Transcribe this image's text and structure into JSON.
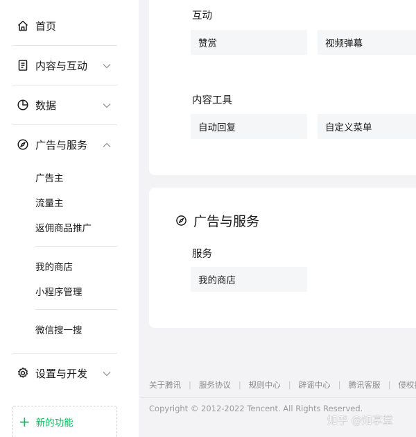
{
  "sidebar": {
    "home": {
      "label": "首页",
      "icon": "home-icon"
    },
    "content": {
      "label": "内容与互动",
      "icon": "document-icon"
    },
    "data": {
      "label": "数据",
      "icon": "pie-chart-icon"
    },
    "ads": {
      "label": "广告与服务",
      "icon": "compass-icon",
      "sub_items": [
        {
          "label": "广告主"
        },
        {
          "label": "流量主"
        },
        {
          "label": "返佣商品推广"
        },
        {
          "label": "我的商店"
        },
        {
          "label": "小程序管理"
        },
        {
          "label": "微信搜一搜"
        }
      ]
    },
    "settings": {
      "label": "设置与开发",
      "icon": "gear-icon"
    },
    "new_feature": {
      "label": "新的功能"
    }
  },
  "main": {
    "interaction": {
      "label": "互动",
      "tiles": [
        {
          "label": "赞赏"
        },
        {
          "label": "视频弹幕"
        }
      ]
    },
    "content_tools": {
      "label": "内容工具",
      "tiles": [
        {
          "label": "自动回复"
        },
        {
          "label": "自定义菜单"
        }
      ]
    },
    "ads_card": {
      "title": "广告与服务",
      "services_label": "服务",
      "tiles": [
        {
          "label": "我的商店"
        }
      ]
    }
  },
  "footer": {
    "links": [
      "关于腾讯",
      "服务协议",
      "规则中心",
      "辟谣中心",
      "腾讯客服",
      "侵权投诉"
    ],
    "copyright": "Copyright © 2012-2022 Tencent. All Rights Reserved.",
    "watermark": "知乎 @知享堂"
  },
  "colors": {
    "accent": "#07c160",
    "tile_bg": "#f5f6f7",
    "page_bg": "#f3f3f5"
  }
}
